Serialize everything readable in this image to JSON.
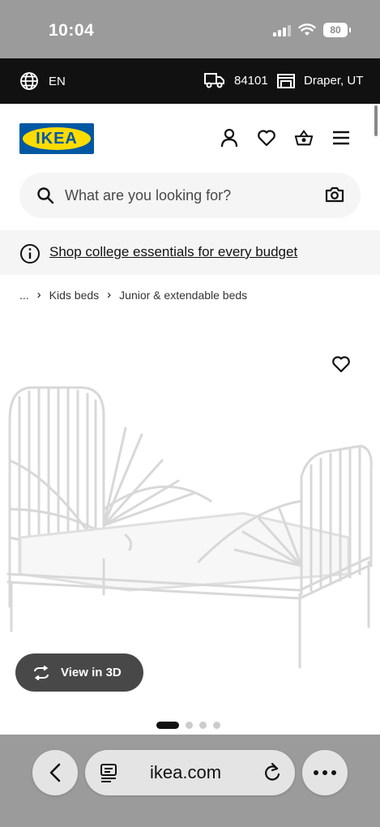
{
  "status_bar": {
    "time": "10:04",
    "battery": "80"
  },
  "top_bar": {
    "language": "EN",
    "zip": "84101",
    "store": "Draper, UT"
  },
  "header": {
    "logo_text": "IKEA",
    "icons": [
      "profile-icon",
      "heart-icon",
      "basket-icon",
      "menu-icon"
    ]
  },
  "search": {
    "placeholder": "What are you looking for?"
  },
  "banner": {
    "text": "Shop college essentials for every budget"
  },
  "breadcrumb": {
    "ellipsis": "...",
    "items": [
      "Kids beds",
      "Junior & extendable beds"
    ]
  },
  "product": {
    "view3d_label": "View in 3D",
    "image_count": 4,
    "active_image": 1
  },
  "safari": {
    "url": "ikea.com"
  },
  "colors": {
    "ikea_blue": "#0058a3",
    "ikea_yellow": "#ffdb00",
    "top_bar_bg": "#111111",
    "pill_bg": "#484848"
  }
}
